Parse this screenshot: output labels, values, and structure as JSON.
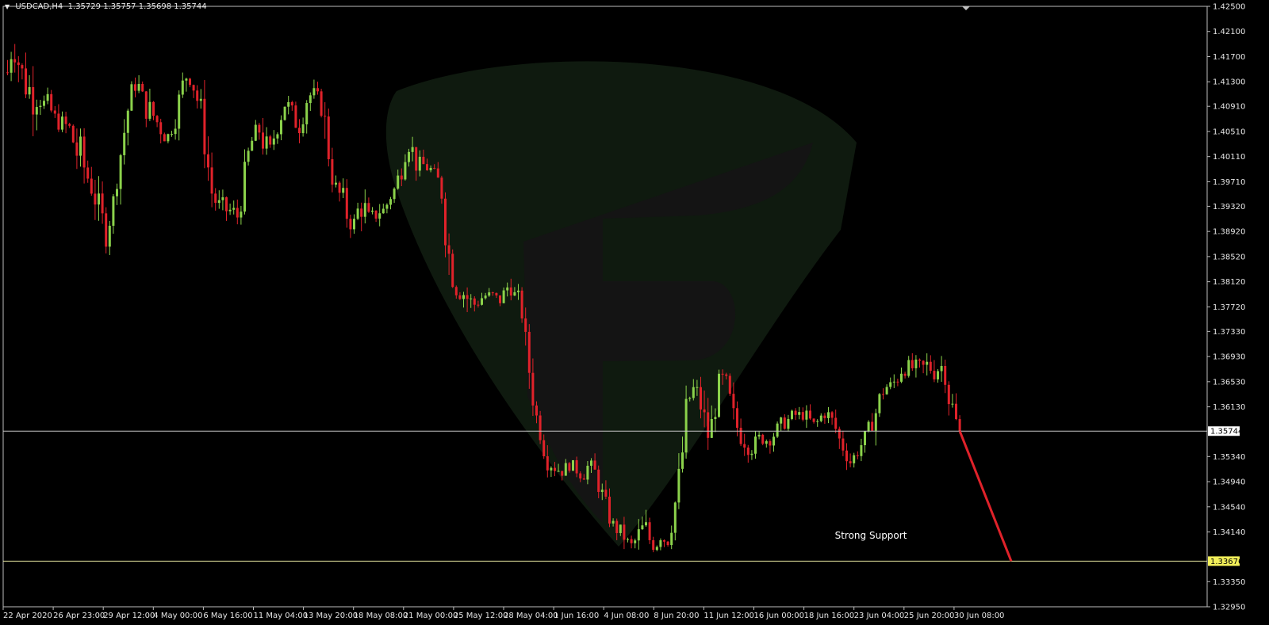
{
  "header": {
    "symbol": "USDCAD,H4",
    "ohlc": "1.35729 1.35757 1.35698 1.35744"
  },
  "colors": {
    "background": "#000000",
    "bull": "#8bd24b",
    "bear": "#e0222a",
    "grid_border": "#bbbbbb",
    "current_label_bg": "#ffffff",
    "support_label_bg": "#f3f05a",
    "projection": "#e0222a"
  },
  "chart_data": {
    "type": "candlestick",
    "ylim": [
      1.3295,
      1.425
    ],
    "y_ticks": [
      "1.42500",
      "1.42100",
      "1.41700",
      "1.41300",
      "1.40910",
      "1.40510",
      "1.40110",
      "1.39710",
      "1.39320",
      "1.38920",
      "1.38520",
      "1.38120",
      "1.37720",
      "1.37330",
      "1.36930",
      "1.36530",
      "1.36130",
      "1.35340",
      "1.34940",
      "1.34540",
      "1.34140",
      "1.33350",
      "1.32950"
    ],
    "x_ticks": [
      "22 Apr 2020",
      "26 Apr 23:00",
      "29 Apr 12:00",
      "4 May 00:00",
      "6 May 16:00",
      "11 May 04:00",
      "13 May 20:00",
      "18 May 08:00",
      "21 May 00:00",
      "25 May 12:00",
      "28 May 04:00",
      "1 Jun 16:00",
      "4 Jun 08:00",
      "8 Jun 20:00",
      "11 Jun 12:00",
      "16 Jun 00:00",
      "18 Jun 16:00",
      "23 Jun 04:00",
      "25 Jun 20:00",
      "30 Jun 08:00"
    ],
    "price_path": [
      [
        1.418,
        1.411
      ],
      [
        1.4215,
        1.417
      ],
      [
        1.42,
        1.413
      ],
      [
        1.417,
        1.41
      ],
      [
        1.416,
        1.408
      ],
      [
        1.414,
        1.407
      ],
      [
        1.413,
        1.409
      ],
      [
        1.412,
        1.406
      ],
      [
        1.411,
        1.407
      ],
      [
        1.409,
        1.405
      ],
      [
        1.408,
        1.405
      ],
      [
        1.408,
        1.404
      ],
      [
        1.407,
        1.404
      ],
      [
        1.405,
        1.399
      ],
      [
        1.405,
        1.397
      ],
      [
        1.401,
        1.396
      ],
      [
        1.399,
        1.394
      ],
      [
        1.397,
        1.391
      ],
      [
        1.394,
        1.388
      ],
      [
        1.392,
        1.386
      ],
      [
        1.394,
        1.392
      ],
      [
        1.401,
        1.396
      ],
      [
        1.406,
        1.401
      ],
      [
        1.411,
        1.406
      ],
      [
        1.414,
        1.411
      ],
      [
        1.414,
        1.411
      ],
      [
        1.412,
        1.407
      ],
      [
        1.411,
        1.406
      ],
      [
        1.41,
        1.405
      ],
      [
        1.408,
        1.404
      ],
      [
        1.406,
        1.403
      ],
      [
        1.405,
        1.404
      ],
      [
        1.409,
        1.405
      ],
      [
        1.413,
        1.409
      ],
      [
        1.416,
        1.412
      ],
      [
        1.416,
        1.412
      ],
      [
        1.413,
        1.409
      ],
      [
        1.411,
        1.405
      ],
      [
        1.405,
        1.398
      ],
      [
        1.398,
        1.393
      ],
      [
        1.395,
        1.392
      ],
      [
        1.395,
        1.391
      ],
      [
        1.394,
        1.391
      ],
      [
        1.394,
        1.391
      ],
      [
        1.393,
        1.39
      ],
      [
        1.399,
        1.393
      ],
      [
        1.404,
        1.398
      ],
      [
        1.406,
        1.403
      ],
      [
        1.407,
        1.404
      ],
      [
        1.407,
        1.4
      ],
      [
        1.403,
        1.4
      ],
      [
        1.406,
        1.403
      ],
      [
        1.409,
        1.405
      ],
      [
        1.411,
        1.408
      ],
      [
        1.411,
        1.406
      ],
      [
        1.408,
        1.405
      ],
      [
        1.408,
        1.404
      ],
      [
        1.412,
        1.408
      ],
      [
        1.413,
        1.409
      ],
      [
        1.412,
        1.41
      ],
      [
        1.411,
        1.407
      ],
      [
        1.409,
        1.4
      ],
      [
        1.4,
        1.396
      ],
      [
        1.397,
        1.394
      ],
      [
        1.397,
        1.392
      ],
      [
        1.394,
        1.389
      ],
      [
        1.391,
        1.389
      ],
      [
        1.395,
        1.39
      ],
      [
        1.396,
        1.391
      ],
      [
        1.393,
        1.389
      ],
      [
        1.393,
        1.39
      ],
      [
        1.394,
        1.391
      ],
      [
        1.394,
        1.391
      ],
      [
        1.396,
        1.393
      ],
      [
        1.397,
        1.395
      ],
      [
        1.401,
        1.396
      ],
      [
        1.404,
        1.4
      ],
      [
        1.405,
        1.402
      ],
      [
        1.402,
        1.398
      ],
      [
        1.401,
        1.399
      ],
      [
        1.401,
        1.398
      ],
      [
        1.4,
        1.398
      ],
      [
        1.399,
        1.397
      ],
      [
        1.398,
        1.393
      ],
      [
        1.392,
        1.383
      ],
      [
        1.384,
        1.38
      ],
      [
        1.381,
        1.378
      ],
      [
        1.381,
        1.378
      ],
      [
        1.381,
        1.376
      ],
      [
        1.379,
        1.376
      ],
      [
        1.379,
        1.377
      ],
      [
        1.38,
        1.378
      ],
      [
        1.38,
        1.378
      ],
      [
        1.38,
        1.378
      ],
      [
        1.379,
        1.377
      ],
      [
        1.381,
        1.378
      ],
      [
        1.383,
        1.379
      ],
      [
        1.38,
        1.378
      ],
      [
        1.38,
        1.377
      ],
      [
        1.374,
        1.369
      ],
      [
        1.369,
        1.362
      ],
      [
        1.362,
        1.358
      ],
      [
        1.358,
        1.355
      ],
      [
        1.355,
        1.351
      ],
      [
        1.353,
        1.351
      ],
      [
        1.353,
        1.35
      ],
      [
        1.352,
        1.35
      ],
      [
        1.353,
        1.351
      ],
      [
        1.353,
        1.351
      ],
      [
        1.352,
        1.35
      ],
      [
        1.352,
        1.349
      ],
      [
        1.353,
        1.351
      ],
      [
        1.353,
        1.35
      ],
      [
        1.351,
        1.347
      ],
      [
        1.348,
        1.345
      ],
      [
        1.346,
        1.342
      ],
      [
        1.343,
        1.341
      ],
      [
        1.343,
        1.34
      ],
      [
        1.342,
        1.339
      ],
      [
        1.34,
        1.338
      ],
      [
        1.341,
        1.339
      ],
      [
        1.344,
        1.339
      ],
      [
        1.344,
        1.34
      ],
      [
        1.341,
        1.338
      ],
      [
        1.341,
        1.338
      ],
      [
        1.342,
        1.34
      ],
      [
        1.341,
        1.338
      ],
      [
        1.345,
        1.341
      ],
      [
        1.35,
        1.346
      ],
      [
        1.358,
        1.35
      ],
      [
        1.366,
        1.358
      ],
      [
        1.366,
        1.362
      ],
      [
        1.365,
        1.362
      ],
      [
        1.363,
        1.356
      ],
      [
        1.359,
        1.354
      ],
      [
        1.362,
        1.358
      ],
      [
        1.367,
        1.362
      ],
      [
        1.368,
        1.363
      ],
      [
        1.365,
        1.359
      ],
      [
        1.361,
        1.357
      ],
      [
        1.359,
        1.355
      ],
      [
        1.358,
        1.354
      ],
      [
        1.357,
        1.353
      ],
      [
        1.357,
        1.354
      ],
      [
        1.358,
        1.355
      ],
      [
        1.357,
        1.355
      ],
      [
        1.358,
        1.355
      ],
      [
        1.359,
        1.356
      ],
      [
        1.36,
        1.357
      ],
      [
        1.36,
        1.358
      ],
      [
        1.361,
        1.359
      ],
      [
        1.361,
        1.359
      ],
      [
        1.361,
        1.359
      ],
      [
        1.361,
        1.358
      ],
      [
        1.359,
        1.358
      ],
      [
        1.36,
        1.358
      ],
      [
        1.362,
        1.359
      ],
      [
        1.361,
        1.359
      ],
      [
        1.36,
        1.357
      ],
      [
        1.358,
        1.354
      ],
      [
        1.356,
        1.353
      ],
      [
        1.354,
        1.351
      ],
      [
        1.355,
        1.352
      ],
      [
        1.356,
        1.354
      ],
      [
        1.358,
        1.355
      ],
      [
        1.36,
        1.357
      ],
      [
        1.363,
        1.358
      ],
      [
        1.365,
        1.362
      ],
      [
        1.366,
        1.363
      ],
      [
        1.366,
        1.363
      ],
      [
        1.368,
        1.364
      ],
      [
        1.369,
        1.366
      ],
      [
        1.369,
        1.366
      ],
      [
        1.369,
        1.366
      ],
      [
        1.369,
        1.366
      ],
      [
        1.369,
        1.366
      ],
      [
        1.37,
        1.366
      ],
      [
        1.369,
        1.365
      ],
      [
        1.369,
        1.366
      ],
      [
        1.37,
        1.366
      ],
      [
        1.367,
        1.359
      ],
      [
        1.362,
        1.3572
      ],
      [
        1.35757,
        1.35698
      ]
    ],
    "current_price": "1.35744",
    "support_price": "1.33676",
    "annotation": "Strong Support",
    "projection": {
      "from_price": 1.35744,
      "to_price": 1.33676,
      "direction": "down"
    }
  }
}
